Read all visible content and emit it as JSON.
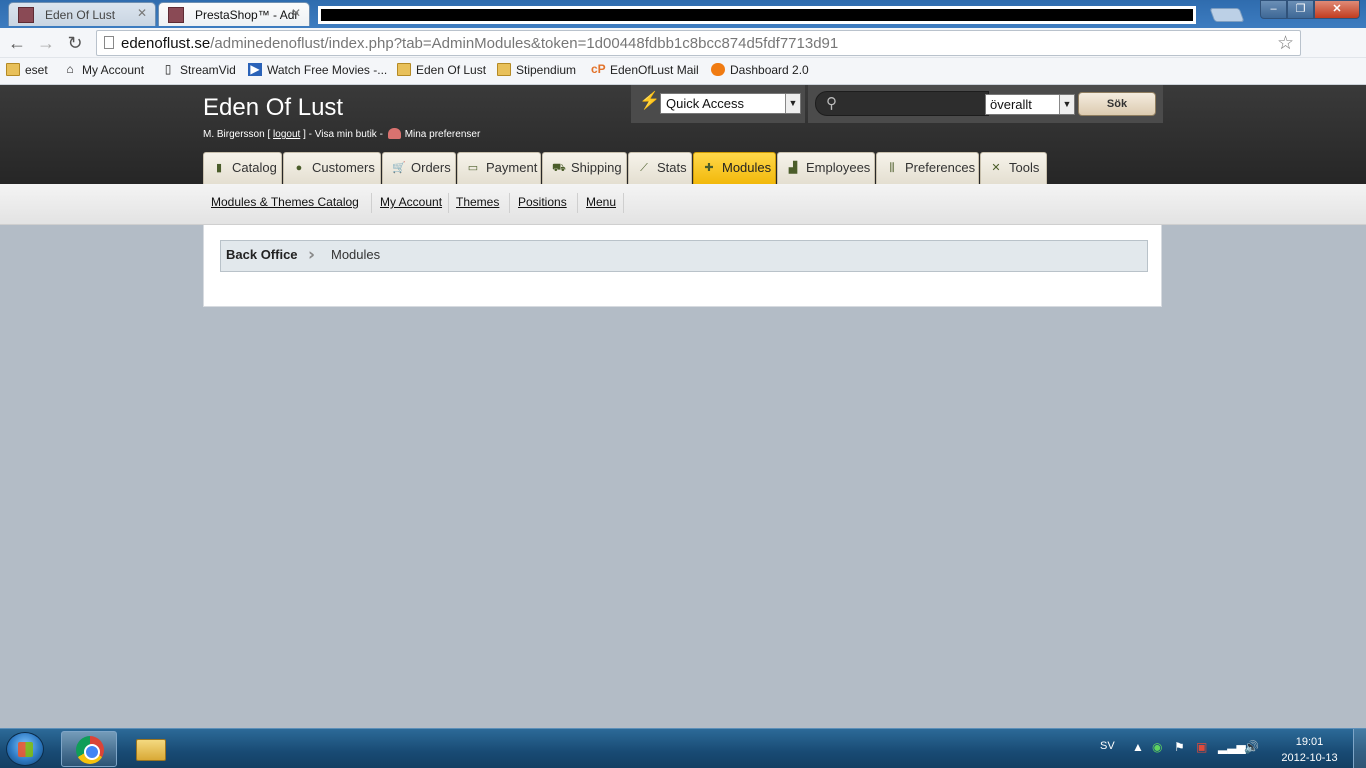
{
  "browser": {
    "tabs": [
      {
        "title": "Eden Of Lust",
        "active": false
      },
      {
        "title": "PrestaShop™ - Adr",
        "active": true
      }
    ],
    "url_host": "edenoflust.se",
    "url_path": "/adminedenoflust/index.php?tab=AdminModules&token=1d00448fdbb1c8bcc874d5fdf7713d91",
    "bookmarks": [
      {
        "label": "eset",
        "icon": "folder-icon"
      },
      {
        "label": "My Account",
        "icon": "house-icon"
      },
      {
        "label": "StreamVid",
        "icon": "page-icon"
      },
      {
        "label": "Watch Free Movies -...",
        "icon": "movie-icon"
      },
      {
        "label": "Eden Of Lust",
        "icon": "folder-icon"
      },
      {
        "label": "Stipendium",
        "icon": "folder-icon"
      },
      {
        "label": "EdenOfLust Mail",
        "icon": "cpanel-icon"
      },
      {
        "label": "Dashboard 2.0",
        "icon": "dashboard-icon"
      }
    ]
  },
  "header": {
    "shop_name": "Eden Of Lust",
    "user": "M. Birgersson [",
    "logout": "logout",
    "after_logout": "] - Visa min butik -",
    "preferences": "Mina preferenser",
    "quick_access": "Quick Access",
    "search_scope": "överallt",
    "search_button": "Sök",
    "search_placeholder": ""
  },
  "main_menu": [
    {
      "label": "Catalog",
      "icon": "book-icon",
      "active": false
    },
    {
      "label": "Customers",
      "icon": "user-icon",
      "active": false
    },
    {
      "label": "Orders",
      "icon": "cart-icon",
      "active": false
    },
    {
      "label": "Payment",
      "icon": "card-icon",
      "active": false
    },
    {
      "label": "Shipping",
      "icon": "truck-icon",
      "active": false
    },
    {
      "label": "Stats",
      "icon": "chart-icon",
      "active": false
    },
    {
      "label": "Modules",
      "icon": "puzzle-icon",
      "active": true
    },
    {
      "label": "Employees",
      "icon": "people-icon",
      "active": false
    },
    {
      "label": "Preferences",
      "icon": "sliders-icon",
      "active": false
    },
    {
      "label": "Tools",
      "icon": "tools-icon",
      "active": false
    }
  ],
  "sub_menu": [
    "Modules & Themes Catalog",
    "My Account",
    "Themes",
    "Positions",
    "Menu"
  ],
  "breadcrumb": {
    "root": "Back Office",
    "current": "Modules"
  },
  "taskbar": {
    "language": "SV",
    "time": "19:01",
    "date": "2012-10-13"
  },
  "colors": {
    "active_tab": "#f2b90b",
    "page_background": "#b3bcc6",
    "header_background": "#2f2f2f"
  }
}
